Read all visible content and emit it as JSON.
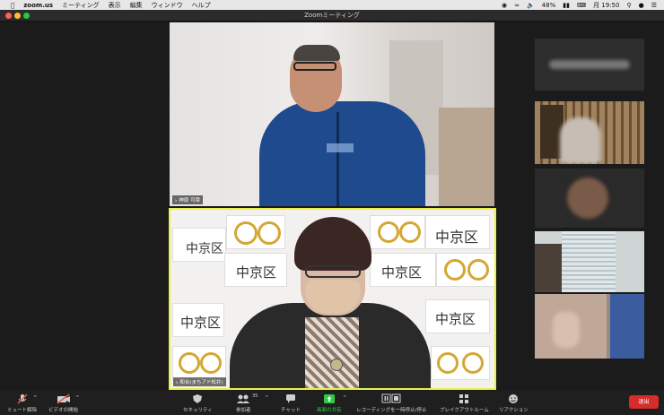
{
  "menubar": {
    "app": "zoom.us",
    "items": [
      "ミーティング",
      "表示",
      "編集",
      "ウィンドウ",
      "ヘルプ"
    ],
    "battery": "48%",
    "clock": "月 19:50"
  },
  "window": {
    "title": "Zoomミーティング"
  },
  "participants": {
    "top": {
      "name": "神原 可章"
    },
    "bottom": {
      "name": "和合(まちアド松井)"
    }
  },
  "signs": {
    "text": "中京区"
  },
  "toolbar": {
    "mute": "ミュート解除",
    "video": "ビデオの開始",
    "security": "セキュリティ",
    "participants": "参加者",
    "participant_count": "35",
    "chat": "チャット",
    "share": "画面の共有",
    "record": "レコーディングを一時停止/停止",
    "breakout": "ブレイクアウトルーム",
    "reactions": "リアクション",
    "end": "退出"
  },
  "colors": {
    "accent_green": "#2ecc40",
    "end_red": "#d72c2c",
    "active_speaker": "#e9f14a"
  }
}
